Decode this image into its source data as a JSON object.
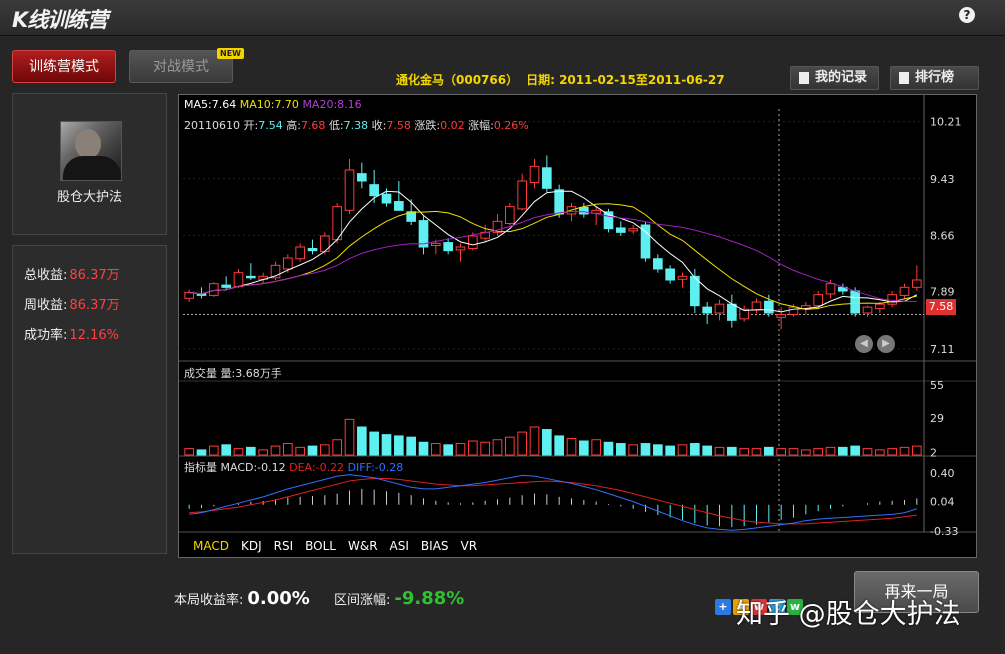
{
  "app": {
    "title": "K线训练营",
    "help_icon": "?"
  },
  "modes": {
    "training": "训练营模式",
    "battle": "对战模式",
    "new_badge": "NEW"
  },
  "profile": {
    "name": "股仓大护法"
  },
  "stats": [
    {
      "label": "总收益:",
      "value": "86.37万"
    },
    {
      "label": "周收益:",
      "value": "86.37万"
    },
    {
      "label": "成功率:",
      "value": "12.16%"
    }
  ],
  "stock": {
    "name": "通化金马（000766）",
    "date_range": "日期: 2011-02-15至2011-06-27"
  },
  "buttons": {
    "records": "我的记录",
    "ranking": "排行榜",
    "replay": "再来一局"
  },
  "chart": {
    "ma_legend": {
      "ma5": "MA5:7.64",
      "ma10": "MA10:7.70",
      "ma20": "MA20:8.16"
    },
    "ohlc": {
      "date": "20110610",
      "open_label": "开:",
      "open": "7.54",
      "high_label": "高:",
      "high": "7.68",
      "low_label": "低:",
      "low": "7.38",
      "close_label": "收:",
      "close": "7.58",
      "change_label": "涨跌:",
      "change": "0.02",
      "pct_label": "涨幅:",
      "pct": "0.26%"
    },
    "price_ticks": [
      "10.21",
      "9.43",
      "8.66",
      "7.89",
      "7.11"
    ],
    "current_price": "7.58",
    "volume_label": "成交量 量:3.68万手",
    "volume_ticks": [
      "55",
      "29",
      "2"
    ],
    "macd_label": {
      "prefix": "指标量 MACD:-0.12",
      "dea": "DEA:-0.22",
      "diff": "DIFF:-0.28"
    },
    "macd_ticks": [
      "0.40",
      "0.04",
      "-0.33"
    ],
    "indicator_tabs": [
      "MACD",
      "KDJ",
      "RSI",
      "BOLL",
      "W&R",
      "ASI",
      "BIAS",
      "VR"
    ],
    "colors": {
      "up": "#ff3b3b",
      "down": "#5ef0f0",
      "ma5": "#ffffff",
      "ma10": "#f0e000",
      "ma20": "#a020c0",
      "dea": "#e02020",
      "diff": "#3070ff"
    }
  },
  "bottom": {
    "round_return_label": "本局收益率:",
    "round_return": "0.00%",
    "range_change_label": "区间涨幅:",
    "range_change": "-9.88%"
  },
  "watermark": "知乎 @股仓大护法",
  "chart_data": {
    "type": "candlestick",
    "y_range": [
      7.0,
      10.3
    ],
    "candles": [
      [
        7.8,
        7.92,
        7.75,
        7.88
      ],
      [
        7.86,
        7.95,
        7.8,
        7.84
      ],
      [
        7.84,
        8.02,
        7.82,
        8.0
      ],
      [
        7.98,
        8.1,
        7.92,
        7.95
      ],
      [
        7.96,
        8.2,
        7.94,
        8.15
      ],
      [
        8.1,
        8.28,
        8.05,
        8.08
      ],
      [
        8.06,
        8.15,
        8.0,
        8.1
      ],
      [
        8.08,
        8.3,
        8.05,
        8.25
      ],
      [
        8.2,
        8.4,
        8.15,
        8.35
      ],
      [
        8.34,
        8.55,
        8.3,
        8.5
      ],
      [
        8.48,
        8.6,
        8.4,
        8.45
      ],
      [
        8.44,
        8.7,
        8.4,
        8.65
      ],
      [
        8.6,
        9.1,
        8.55,
        9.05
      ],
      [
        9.0,
        9.7,
        8.95,
        9.55
      ],
      [
        9.5,
        9.65,
        9.3,
        9.4
      ],
      [
        9.35,
        9.55,
        9.1,
        9.2
      ],
      [
        9.22,
        9.3,
        9.05,
        9.1
      ],
      [
        9.12,
        9.4,
        9.0,
        9.0
      ],
      [
        8.98,
        9.15,
        8.8,
        8.85
      ],
      [
        8.86,
        8.92,
        8.4,
        8.5
      ],
      [
        8.52,
        8.6,
        8.4,
        8.55
      ],
      [
        8.56,
        8.62,
        8.4,
        8.45
      ],
      [
        8.46,
        8.55,
        8.3,
        8.5
      ],
      [
        8.48,
        8.7,
        8.45,
        8.65
      ],
      [
        8.62,
        8.8,
        8.58,
        8.7
      ],
      [
        8.7,
        8.95,
        8.65,
        8.85
      ],
      [
        8.82,
        9.1,
        8.8,
        9.05
      ],
      [
        9.02,
        9.5,
        9.0,
        9.4
      ],
      [
        9.38,
        9.7,
        9.3,
        9.6
      ],
      [
        9.58,
        9.75,
        9.25,
        9.3
      ],
      [
        9.28,
        9.35,
        8.9,
        8.95
      ],
      [
        8.95,
        9.1,
        8.85,
        9.05
      ],
      [
        9.04,
        9.1,
        8.9,
        8.95
      ],
      [
        8.96,
        9.05,
        8.8,
        9.0
      ],
      [
        8.98,
        9.02,
        8.7,
        8.75
      ],
      [
        8.76,
        8.85,
        8.65,
        8.7
      ],
      [
        8.72,
        8.8,
        8.68,
        8.75
      ],
      [
        8.8,
        8.85,
        8.3,
        8.35
      ],
      [
        8.34,
        8.4,
        8.15,
        8.2
      ],
      [
        8.2,
        8.25,
        8.0,
        8.05
      ],
      [
        8.06,
        8.15,
        7.95,
        8.1
      ],
      [
        8.1,
        8.2,
        7.6,
        7.7
      ],
      [
        7.68,
        7.75,
        7.45,
        7.6
      ],
      [
        7.6,
        7.78,
        7.5,
        7.72
      ],
      [
        7.72,
        7.85,
        7.4,
        7.5
      ],
      [
        7.52,
        7.7,
        7.48,
        7.65
      ],
      [
        7.64,
        7.8,
        7.6,
        7.75
      ],
      [
        7.76,
        7.85,
        7.55,
        7.6
      ],
      [
        7.54,
        7.68,
        7.38,
        7.58
      ],
      [
        7.58,
        7.72,
        7.55,
        7.68
      ],
      [
        7.66,
        7.75,
        7.58,
        7.7
      ],
      [
        7.7,
        7.9,
        7.65,
        7.85
      ],
      [
        7.86,
        8.05,
        7.8,
        8.0
      ],
      [
        7.95,
        8.0,
        7.85,
        7.9
      ],
      [
        7.9,
        7.95,
        7.55,
        7.6
      ],
      [
        7.6,
        7.7,
        7.55,
        7.68
      ],
      [
        7.66,
        7.75,
        7.6,
        7.72
      ],
      [
        7.72,
        7.9,
        7.68,
        7.85
      ],
      [
        7.84,
        8.0,
        7.8,
        7.95
      ],
      [
        7.95,
        8.25,
        7.9,
        8.05
      ]
    ],
    "volumes": [
      5,
      4,
      7,
      8,
      5,
      6,
      4,
      7,
      9,
      6,
      7,
      8,
      12,
      28,
      22,
      18,
      16,
      15,
      14,
      10,
      9,
      8,
      9,
      11,
      10,
      12,
      14,
      18,
      22,
      20,
      15,
      13,
      11,
      12,
      10,
      9,
      8,
      9,
      8,
      7,
      8,
      9,
      7,
      6,
      6,
      5,
      5,
      6,
      5,
      5,
      4,
      5,
      6,
      6,
      7,
      5,
      4,
      5,
      6,
      7
    ],
    "macd_bars": [
      -0.05,
      -0.04,
      -0.02,
      0.0,
      0.02,
      0.04,
      0.05,
      0.07,
      0.09,
      0.1,
      0.11,
      0.12,
      0.14,
      0.18,
      0.2,
      0.19,
      0.17,
      0.15,
      0.12,
      0.08,
      0.05,
      0.03,
      0.02,
      0.03,
      0.05,
      0.07,
      0.09,
      0.12,
      0.14,
      0.13,
      0.1,
      0.08,
      0.06,
      0.04,
      0.01,
      -0.02,
      -0.05,
      -0.09,
      -0.13,
      -0.16,
      -0.19,
      -0.23,
      -0.26,
      -0.27,
      -0.28,
      -0.27,
      -0.25,
      -0.22,
      -0.19,
      -0.16,
      -0.12,
      -0.08,
      -0.05,
      -0.02,
      0.0,
      0.02,
      0.04,
      0.05,
      0.06,
      0.08
    ],
    "dea": [
      -0.1,
      -0.09,
      -0.07,
      -0.05,
      -0.03,
      0.0,
      0.03,
      0.06,
      0.1,
      0.14,
      0.18,
      0.22,
      0.26,
      0.3,
      0.32,
      0.33,
      0.33,
      0.32,
      0.3,
      0.28,
      0.26,
      0.25,
      0.24,
      0.24,
      0.25,
      0.26,
      0.27,
      0.28,
      0.29,
      0.3,
      0.29,
      0.28,
      0.26,
      0.24,
      0.21,
      0.18,
      0.14,
      0.1,
      0.06,
      0.02,
      -0.02,
      -0.06,
      -0.1,
      -0.14,
      -0.17,
      -0.2,
      -0.22,
      -0.23,
      -0.24,
      -0.24,
      -0.24,
      -0.23,
      -0.22,
      -0.21,
      -0.2,
      -0.19,
      -0.18,
      -0.17,
      -0.15,
      -0.13
    ],
    "diff": [
      -0.12,
      -0.1,
      -0.06,
      -0.02,
      0.02,
      0.06,
      0.1,
      0.15,
      0.2,
      0.24,
      0.28,
      0.32,
      0.36,
      0.38,
      0.36,
      0.34,
      0.3,
      0.26,
      0.22,
      0.2,
      0.2,
      0.22,
      0.24,
      0.26,
      0.28,
      0.31,
      0.34,
      0.37,
      0.36,
      0.33,
      0.3,
      0.27,
      0.23,
      0.19,
      0.14,
      0.09,
      0.04,
      -0.02,
      -0.08,
      -0.14,
      -0.2,
      -0.25,
      -0.29,
      -0.31,
      -0.32,
      -0.31,
      -0.29,
      -0.27,
      -0.25,
      -0.23,
      -0.2,
      -0.18,
      -0.17,
      -0.16,
      -0.15,
      -0.14,
      -0.13,
      -0.12,
      -0.1,
      -0.05
    ]
  }
}
